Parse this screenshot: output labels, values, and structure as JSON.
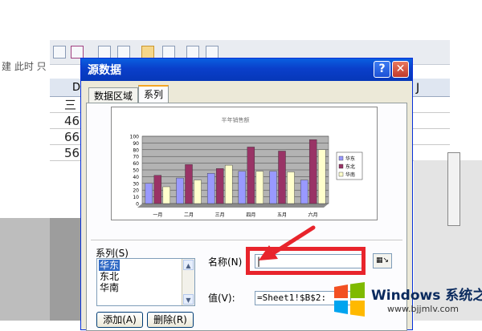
{
  "background_sheet": {
    "formula_hint": "建 此时 只",
    "column_d": "D",
    "column_j": "J",
    "cells": [
      "三",
      "46",
      "66",
      "56"
    ]
  },
  "dialog": {
    "title": "源数据",
    "help_button": "?",
    "close_button": "✕",
    "tabs": [
      {
        "label": "数据区域",
        "active": false
      },
      {
        "label": "系列",
        "active": true
      }
    ],
    "series_section_label": "系列(S)",
    "series_list": [
      "华东",
      "东北",
      "华南"
    ],
    "selected_series": "华东",
    "name_label": "名称(N)",
    "name_value": "|",
    "value_label": "值(V):",
    "value_text": "=Sheet1!$B$2:",
    "add_button": "添加(A)",
    "delete_button": "删除(R)"
  },
  "chart_data": {
    "type": "bar",
    "title": "半年销售额",
    "categories": [
      "一月",
      "二月",
      "三月",
      "四月",
      "五月",
      "六月"
    ],
    "series": [
      {
        "name": "华东",
        "color": "#9999ff",
        "values": [
          30,
          38,
          45,
          48,
          48,
          35
        ]
      },
      {
        "name": "东北",
        "color": "#993366",
        "values": [
          42,
          58,
          52,
          84,
          78,
          95
        ]
      },
      {
        "name": "华南",
        "color": "#ffffcc",
        "values": [
          25,
          35,
          57,
          48,
          47,
          80
        ]
      }
    ],
    "yticks": [
      0,
      10,
      20,
      30,
      40,
      50,
      60,
      70,
      80,
      90,
      100
    ],
    "ylim": [
      0,
      100
    ],
    "grid": true,
    "legend": "right"
  },
  "annotation": {
    "highlight_color": "#e8242c"
  },
  "watermark": {
    "title": "Windows 系统之家",
    "url": "www.bjjmlv.com"
  }
}
